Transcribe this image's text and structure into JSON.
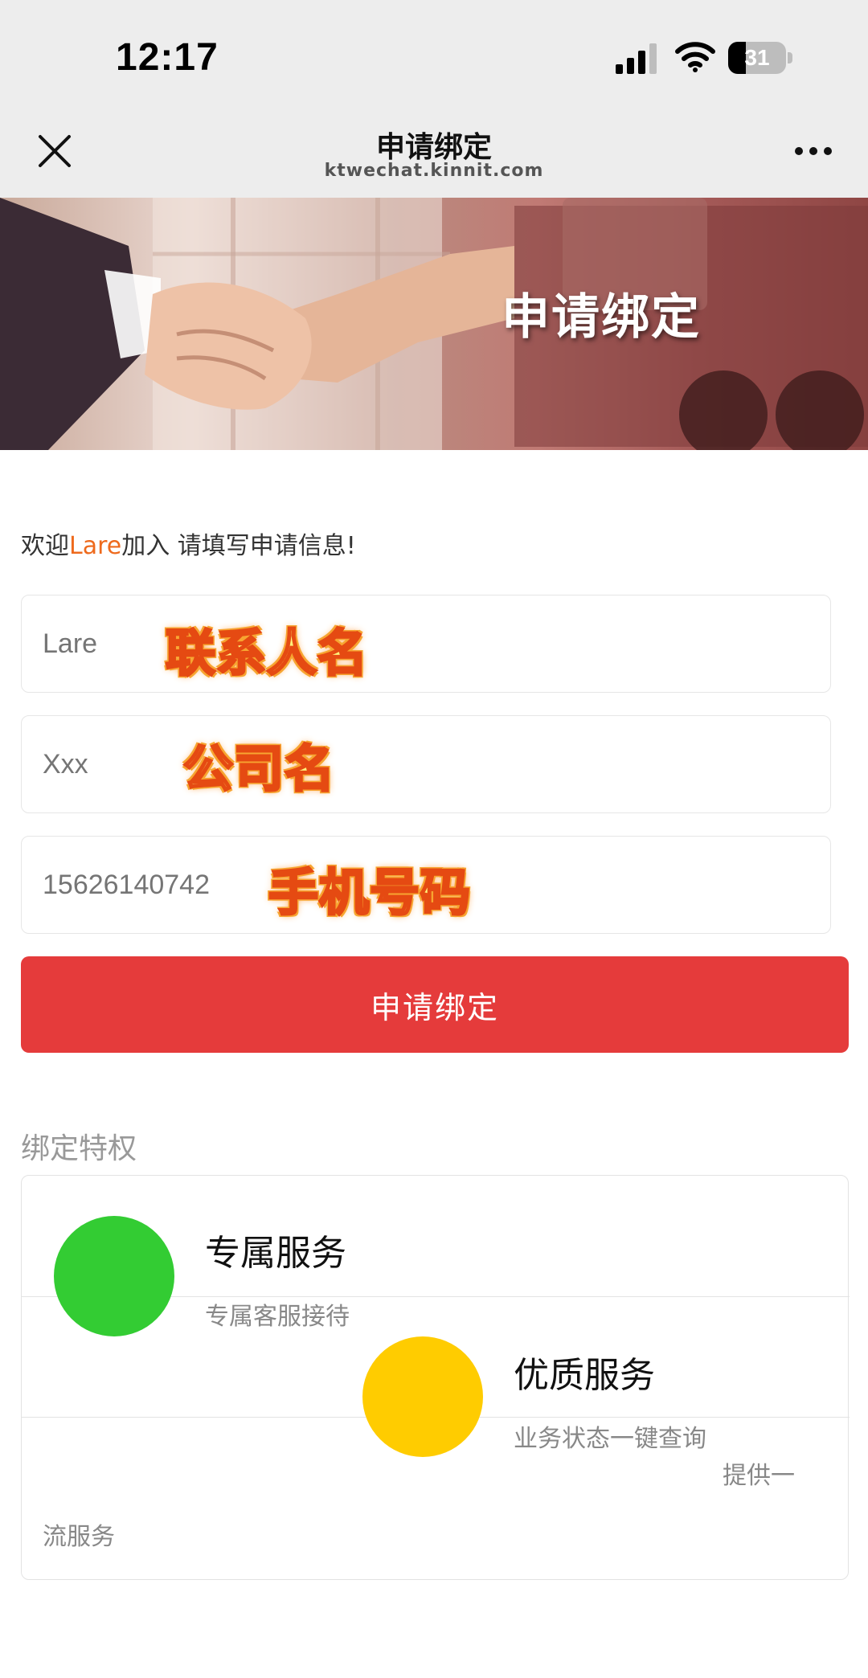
{
  "status_bar": {
    "time": "12:17",
    "battery": "31",
    "battery_fraction": 0.31,
    "icons": [
      "signal-icon",
      "wifi-icon",
      "battery-icon"
    ]
  },
  "nav": {
    "title": "申请绑定",
    "subtitle": "ktwechat.kinnit.com",
    "icons": [
      "close-icon",
      "more-icon"
    ]
  },
  "banner": {
    "title": "申请绑定"
  },
  "form": {
    "welcome_prefix": "欢迎",
    "welcome_name": "Lare",
    "welcome_suffix": "加入 请填写申请信息!",
    "fields": [
      {
        "value": "Lare",
        "annotation": "联系人名"
      },
      {
        "value": "Xxx",
        "annotation": "公司名"
      },
      {
        "value": "15626140742",
        "annotation": "手机号码"
      }
    ],
    "submit_label": "申请绑定"
  },
  "privileges": {
    "title": "绑定特权",
    "items": [
      {
        "title": "专属服务",
        "desc": "专属客服接待",
        "icon_color": "#33cc33"
      },
      {
        "title": "优质服务",
        "desc": "业务状态一键查询",
        "icon_color": "#ffcc00"
      },
      {
        "desc_part1": "提供一",
        "desc_part2": "流服务"
      }
    ]
  },
  "colors": {
    "accent_red": "#e53b3b",
    "name_orange": "#ee6a1d",
    "nav_bg": "#ededed"
  }
}
